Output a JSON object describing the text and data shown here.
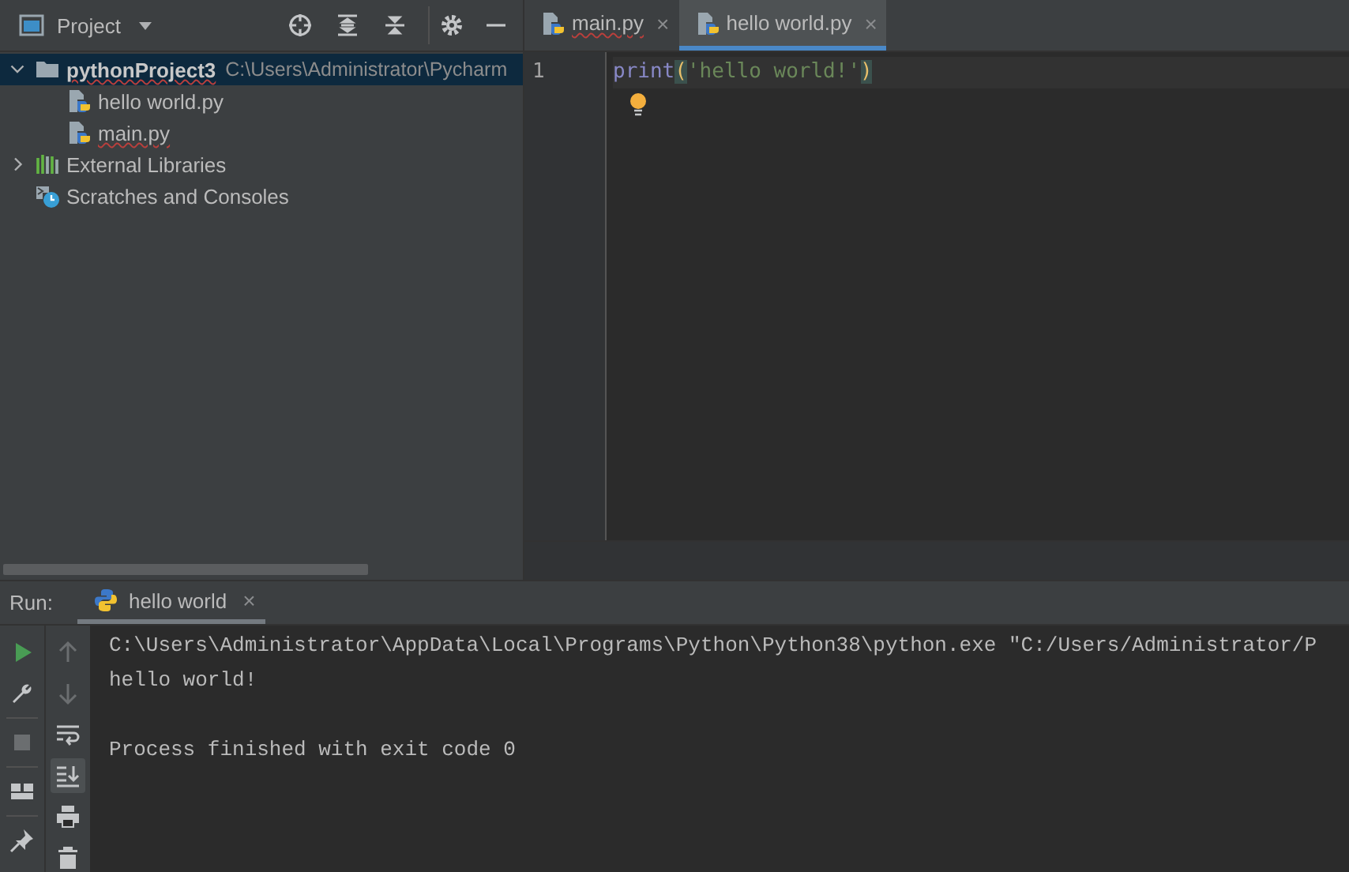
{
  "project_panel": {
    "title": "Project",
    "tree": [
      {
        "kind": "folder",
        "label": "pythonProject3",
        "path": "C:\\Users\\Administrator\\Pycharm",
        "expanded": true,
        "selected": true,
        "spell_error": true,
        "children": [
          {
            "kind": "python",
            "label": "hello world.py",
            "selected": false,
            "spell_error": false
          },
          {
            "kind": "python",
            "label": "main.py",
            "selected": false,
            "spell_error": true
          }
        ]
      },
      {
        "kind": "library",
        "label": "External Libraries",
        "expanded": false,
        "selected": false,
        "spell_error": false
      },
      {
        "kind": "scratch",
        "label": "Scratches and Consoles",
        "selected": false,
        "spell_error": false
      }
    ]
  },
  "editor": {
    "tabs": [
      {
        "label": "main.py",
        "selected": false,
        "spell_error": true,
        "close": "×"
      },
      {
        "label": "hello world.py",
        "selected": true,
        "spell_error": false,
        "close": "×"
      }
    ],
    "lines": [
      {
        "number": "1",
        "tokens": [
          {
            "kind": "function",
            "text": "print"
          },
          {
            "kind": "paren",
            "text": "("
          },
          {
            "kind": "string",
            "text": "'hello world!'"
          },
          {
            "kind": "paren",
            "text": ")"
          }
        ]
      }
    ]
  },
  "run_panel": {
    "label": "Run:",
    "tab": {
      "label": "hello world",
      "close": "×"
    },
    "left_tools": [
      {
        "kind": "run",
        "disabled": false
      },
      {
        "kind": "wrench",
        "disabled": false
      },
      {
        "kind": "stop",
        "disabled": true
      },
      {
        "kind": "layout",
        "disabled": false
      },
      {
        "kind": "pin",
        "disabled": false
      }
    ],
    "right_tools": [
      {
        "kind": "up",
        "disabled": true,
        "on": false
      },
      {
        "kind": "down",
        "disabled": true,
        "on": false
      },
      {
        "kind": "wrap",
        "disabled": false,
        "on": false
      },
      {
        "kind": "scroll-end",
        "disabled": false,
        "on": true
      },
      {
        "kind": "print",
        "disabled": false,
        "on": false
      },
      {
        "kind": "trash",
        "disabled": false,
        "on": false
      }
    ],
    "output": [
      {
        "kind": "command",
        "text": "C:\\Users\\Administrator\\AppData\\Local\\Programs\\Python\\Python38\\python.exe \"C:/Users/Administrator/P"
      },
      {
        "kind": "stdout",
        "text": "hello world!"
      },
      {
        "kind": "exit",
        "text": "Process finished with exit code 0"
      }
    ]
  }
}
